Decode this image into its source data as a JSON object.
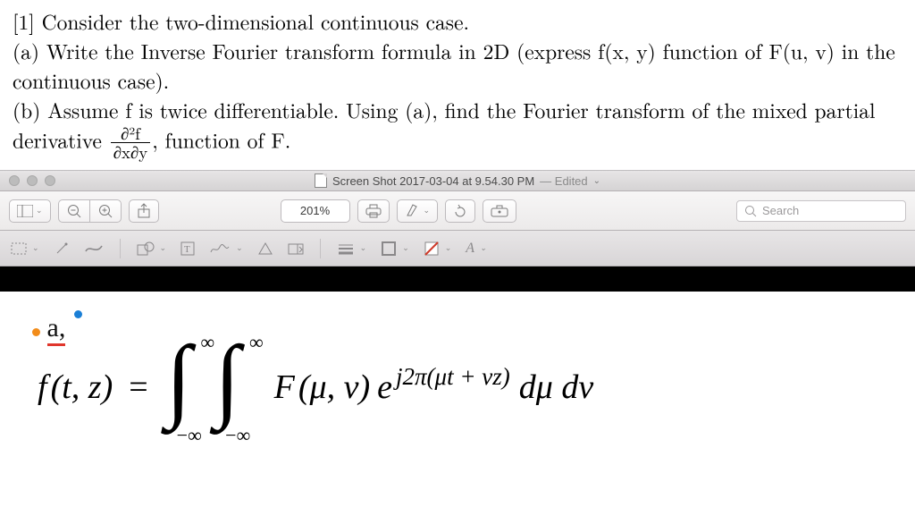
{
  "problem": {
    "heading": "[1] Consider the two-dimensional continuous case.",
    "part_a": "(a) Write the Inverse Fourier transform formula in 2D (express f(x, y) function of F(u, v) in the continuous case).",
    "part_b_lead": "(b) Assume f is twice differentiable. Using (a), find the Fourier transform of the mixed partial derivative ",
    "frac_num": "∂²f",
    "frac_den": "∂x∂y",
    "part_b_tail": ", function of F."
  },
  "window": {
    "title": "Screen Shot 2017-03-04 at 9.54.30 PM",
    "edited": "— Edited",
    "dropdown_glyph": "⌄"
  },
  "toolbar1": {
    "zoom": "201%",
    "search_placeholder": "Search"
  },
  "toolbar2": {
    "text_color_label": "A"
  },
  "equation": {
    "marker": "a,",
    "lhs_f": "f",
    "lhs_args": "(t, z)",
    "eq": "=",
    "ub": "∞",
    "lb": "−∞",
    "F": "F",
    "F_args": "(μ, ν)",
    "e": "e",
    "exp": " j2π(μt + νz)",
    "diff": "dμ dν"
  }
}
